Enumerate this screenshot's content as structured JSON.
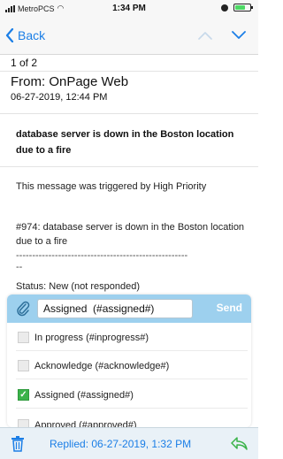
{
  "status_bar": {
    "carrier": "MetroPCS",
    "time": "1:34 PM"
  },
  "nav": {
    "back_label": "Back",
    "icons": [
      "back-chevron-icon",
      "chevron-up-icon",
      "chevron-down-icon"
    ]
  },
  "message": {
    "counter": "1 of 2",
    "from": "From: OnPage Web",
    "date": "06-27-2019, 12:44 PM",
    "subject": "database server is down in the Boston location due to a fire",
    "trigger": "This message was triggered by High Priority",
    "details": "#974: database server is down in the Boston location due to a fire",
    "dashes": "-----------------------------------------------------",
    "dashes_end": "--",
    "status": "Status: New (not responded)"
  },
  "reply": {
    "input_value": "Assigned  (#assigned#)",
    "send_label": "Send",
    "options": [
      {
        "label": "In progress  (#inprogress#)",
        "checked": false
      },
      {
        "label": "Acknowledge  (#acknowledge#)",
        "checked": false
      },
      {
        "label": "Assigned  (#assigned#)",
        "checked": true
      },
      {
        "label": "Approved  (#approved#)",
        "checked": false
      }
    ]
  },
  "footer": {
    "replied": "Replied: 06-27-2019, 1:32 PM",
    "icons": [
      "trash-icon",
      "reply-icon"
    ]
  },
  "colors": {
    "accent": "#1b7ee6",
    "reply_header": "#9dd0ee",
    "check_green": "#3bb34a",
    "footer_bg": "#e9f1f7"
  }
}
